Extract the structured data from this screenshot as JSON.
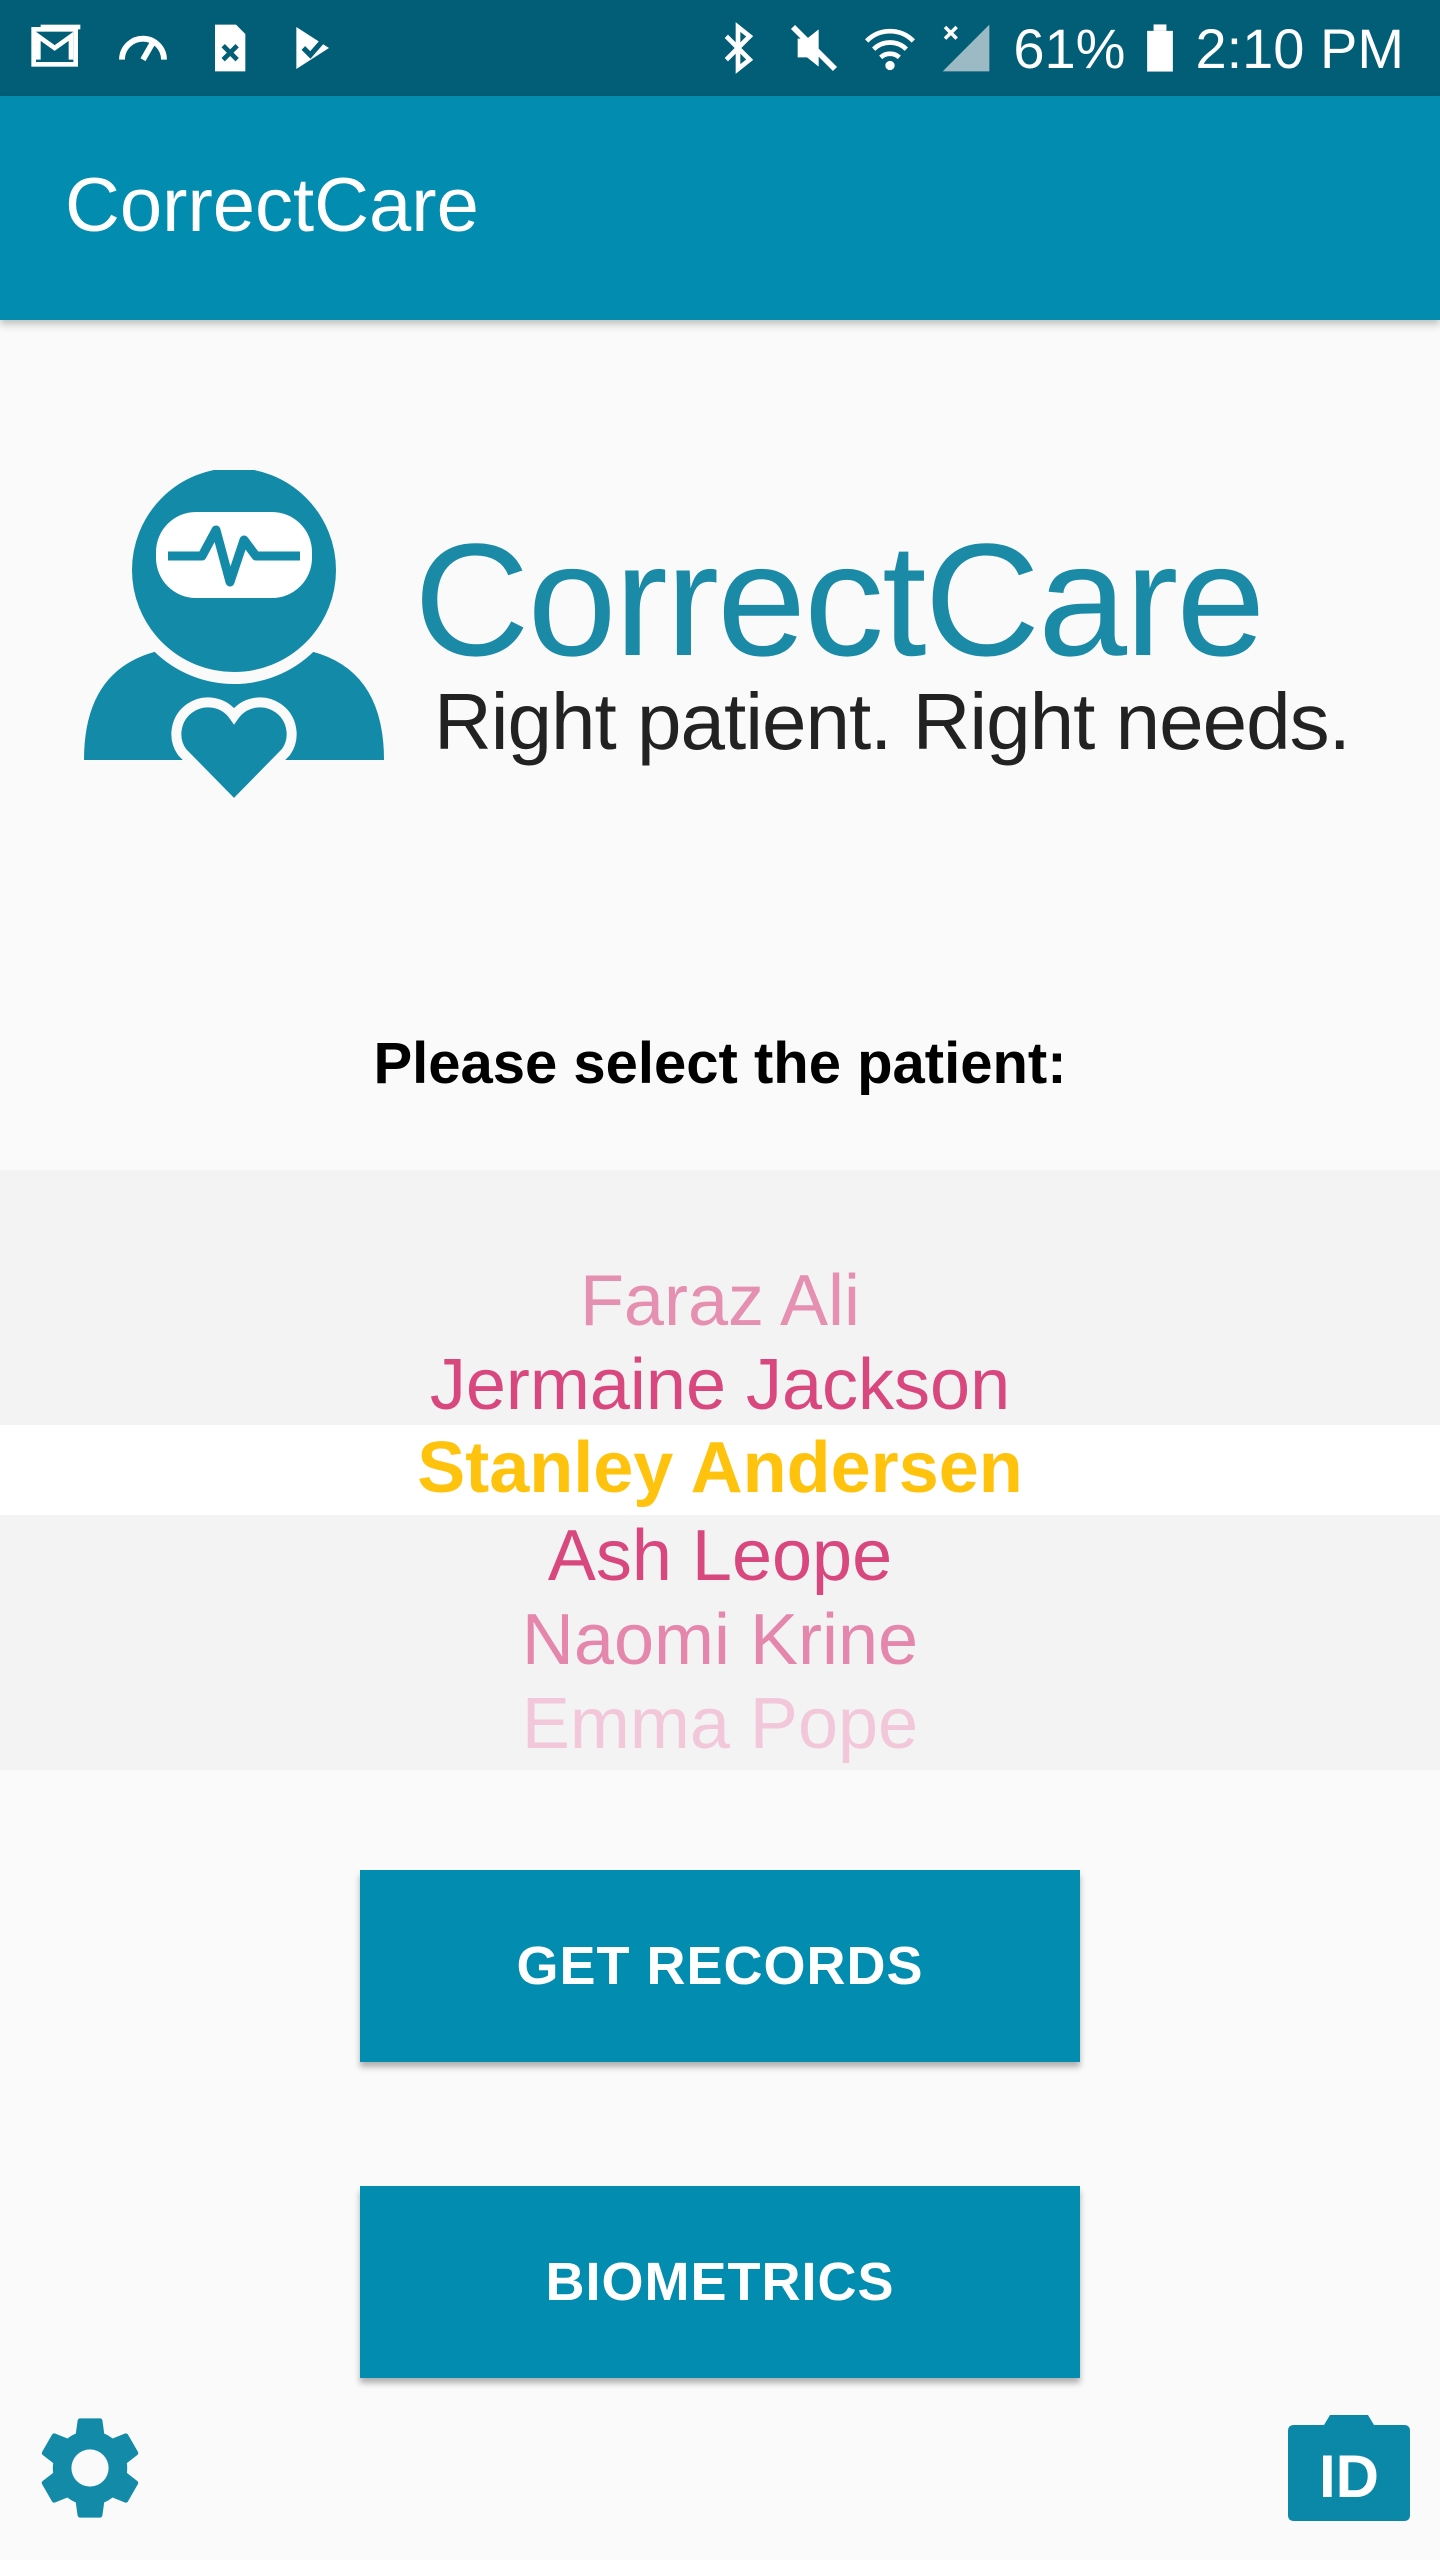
{
  "status_bar": {
    "left_icons": [
      "gmail-icon",
      "speedometer-icon",
      "sim-card-icon",
      "check-icon"
    ],
    "right_icons": [
      "bluetooth-icon",
      "mute-icon",
      "wifi-icon",
      "signal-icon",
      "battery-icon"
    ],
    "battery_percent": "61%",
    "time": "2:10 PM"
  },
  "app_bar": {
    "title": "CorrectCare"
  },
  "logo": {
    "wordmark": "CorrectCare",
    "tagline": "Right patient. Right needs.",
    "icon": "patient-heart-icon"
  },
  "prompt": "Please select the patient:",
  "picker": {
    "items": [
      "Faraz Ali",
      "Jermaine Jackson",
      "Stanley Andersen",
      "Ash Leope",
      "Naomi Krine",
      "Emma Pope"
    ],
    "selected": "Stanley Andersen"
  },
  "buttons": {
    "get_records": "GET RECORDS",
    "biometrics": "BIOMETRICS"
  },
  "bottom_icons": {
    "settings": "gear-icon",
    "id_badge_label": "ID"
  },
  "colors": {
    "primary": "#028cb0",
    "status_bar": "#015e76",
    "selected_item": "#ffc20d",
    "picker_item": "#d9477f"
  }
}
